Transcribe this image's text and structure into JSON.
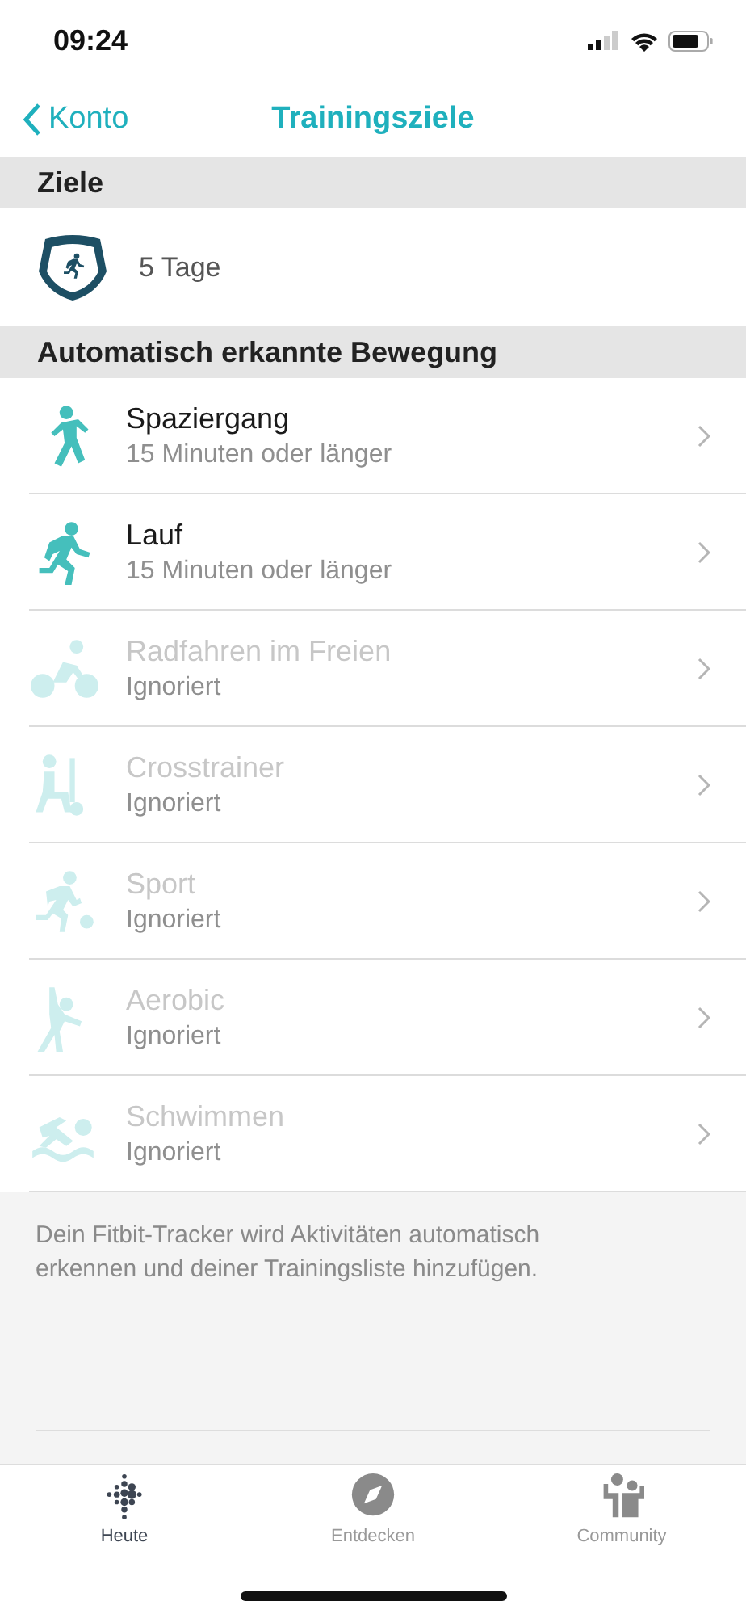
{
  "status_bar": {
    "time": "09:24"
  },
  "nav": {
    "back": "Konto",
    "title": "Trainingsziele"
  },
  "goals_section": {
    "title": "Ziele",
    "goal": "5 Tage"
  },
  "activities_section": {
    "title": "Automatisch erkannte Bewegung",
    "items": [
      {
        "kind": "walk",
        "name": "Spaziergang",
        "detail": "15 Minuten oder länger",
        "enabled": true
      },
      {
        "kind": "run",
        "name": "Lauf",
        "detail": "15 Minuten oder länger",
        "enabled": true
      },
      {
        "kind": "bike",
        "name": "Radfahren im Freien",
        "detail": "Ignoriert",
        "enabled": false
      },
      {
        "kind": "elliptical",
        "name": "Crosstrainer",
        "detail": "Ignoriert",
        "enabled": false
      },
      {
        "kind": "sport",
        "name": "Sport",
        "detail": "Ignoriert",
        "enabled": false
      },
      {
        "kind": "aerobic",
        "name": "Aerobic",
        "detail": "Ignoriert",
        "enabled": false
      },
      {
        "kind": "swim",
        "name": "Schwimmen",
        "detail": "Ignoriert",
        "enabled": false
      }
    ]
  },
  "footnote": "Dein Fitbit-Tracker wird Aktivitäten automatisch erkennen und deiner Trainingsliste hinzufügen.",
  "tab_bar": [
    {
      "kind": "today",
      "label": "Heute",
      "selected": true
    },
    {
      "kind": "discover",
      "label": "Entdecken",
      "selected": false
    },
    {
      "kind": "community",
      "label": "Community",
      "selected": false
    }
  ]
}
